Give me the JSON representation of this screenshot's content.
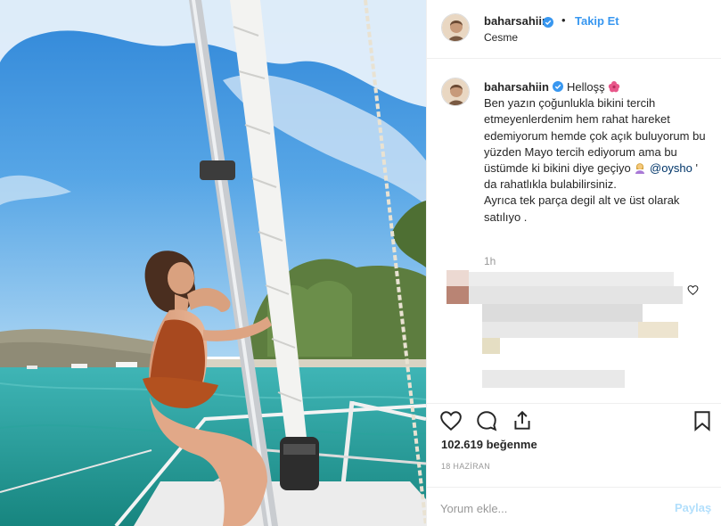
{
  "post": {
    "photo_icon": "sailboat-photo",
    "username": "baharsahiin",
    "verified_icon": "verified-badge-icon",
    "separator": "•",
    "follow_label": "Takip Et",
    "location": "Cesme"
  },
  "caption": {
    "username": "baharsahiin",
    "greeting": "Helloşş",
    "emoji_flower": "hibiscus-emoji",
    "text_part1": "Ben yazın çoğunlukla bikini tercih etmeyenlerdenim hem rahat hareket edemiyorum hemde çok açık buluyorum bu yüzden Mayo tercih ediyorum ama bu üstümde ki bikini diye geçiyo",
    "emoji_person": "person-emoji",
    "mention": "@oysho",
    "text_part2": " ' da rahatlıkla bulabilirsiniz.",
    "text_part3": "Ayrıca tek parça degil alt ve üst olarak satılıyo .",
    "time": "1h"
  },
  "actions": {
    "like_icon": "heart-icon",
    "comment_icon": "comment-icon",
    "share_icon": "share-icon",
    "save_icon": "bookmark-icon",
    "likes": "102.619 beğenme",
    "date": "18 HAZİRAN",
    "comment_placeholder": "Yorum ekle...",
    "post_label": "Paylaş"
  },
  "colors": {
    "link_blue": "#3897f0",
    "verified_blue": "#3897f0",
    "post_disabled": "#b2dffc",
    "mention": "#003569"
  }
}
